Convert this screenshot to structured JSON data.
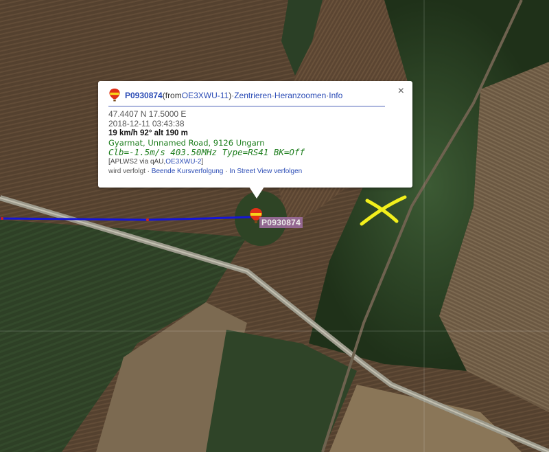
{
  "map": {
    "type": "satellite",
    "track_color": "#1515d8",
    "annotation_color": "#f2ef1c"
  },
  "popup": {
    "callsign": "P0930874",
    "from_prefix": "(from ",
    "from_station": "OE3XWU-11",
    "from_suffix": ")",
    "links": {
      "center": "Zentrieren",
      "zoom": "Heranzoomen",
      "info": "Info"
    },
    "separator": " · ",
    "close_symbol": "×",
    "coordinates": "47.4407 N 17.5000 E",
    "timestamp": "2018-12-11 03:43:38",
    "motion": "19 km/h 92° alt 190 m",
    "address": "Gyarmat, Unnamed Road, 9126 Ungarn",
    "comment": "Clb=-1.5m/s 403.50MHz Type=RS41 BK=Off",
    "path_prefix": "[APLWS2 via qAU,",
    "path_station": "OE3XWU-2",
    "path_suffix": "]",
    "tracked_text": "wird verfolgt",
    "stop_tracking": "Beende Kursverfolgung",
    "street_view": "In Street View verfolgen"
  },
  "marker": {
    "label": "P0930874",
    "icon": "balloon-icon"
  }
}
